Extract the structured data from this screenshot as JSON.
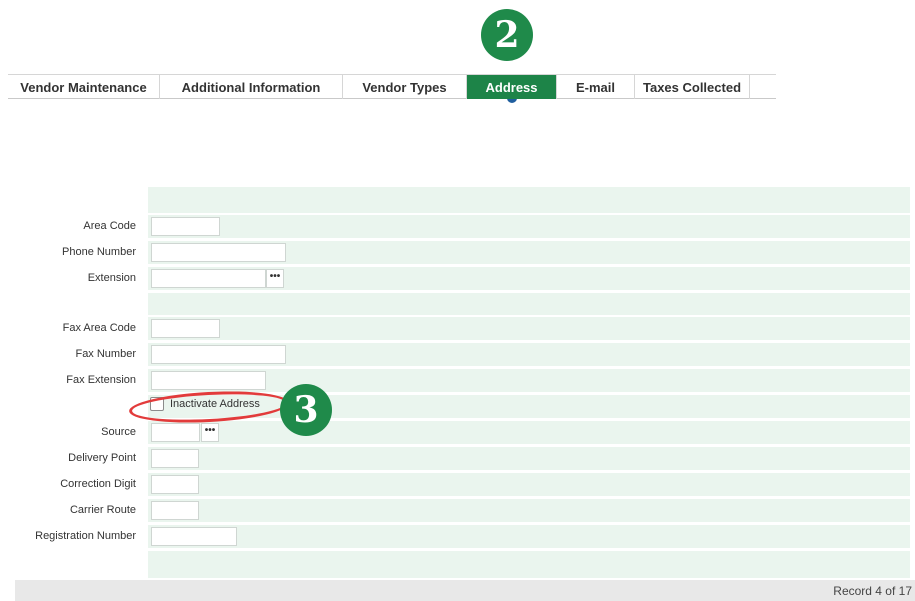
{
  "callouts": {
    "tabs_step": "2",
    "checkbox_step": "3"
  },
  "tabs": [
    {
      "label": "Vendor Maintenance",
      "active": false
    },
    {
      "label": "Additional Information",
      "active": false
    },
    {
      "label": "Vendor Types",
      "active": false
    },
    {
      "label": "Address",
      "active": true
    },
    {
      "label": "E-mail",
      "active": false
    },
    {
      "label": "Taxes Collected",
      "active": false
    }
  ],
  "form": {
    "area_code": {
      "label": "Area Code",
      "value": ""
    },
    "phone_number": {
      "label": "Phone Number",
      "value": ""
    },
    "extension": {
      "label": "Extension",
      "value": "",
      "button": "•••"
    },
    "fax_area_code": {
      "label": "Fax Area Code",
      "value": ""
    },
    "fax_number": {
      "label": "Fax Number",
      "value": ""
    },
    "fax_extension": {
      "label": "Fax Extension",
      "value": ""
    },
    "inactivate_address": {
      "label": "Inactivate Address",
      "checked": false
    },
    "source": {
      "label": "Source",
      "value": "",
      "button": "•••"
    },
    "delivery_point": {
      "label": "Delivery Point",
      "value": ""
    },
    "correction_digit": {
      "label": "Correction Digit",
      "value": ""
    },
    "carrier_route": {
      "label": "Carrier Route",
      "value": ""
    },
    "registration_number": {
      "label": "Registration Number",
      "value": ""
    }
  },
  "status": {
    "record": "Record 4 of 17"
  },
  "colors": {
    "active_tab": "#1d8448",
    "callout": "#1f8a4a",
    "highlight_ring": "#e23b3b",
    "form_band": "#eaf5ee"
  }
}
